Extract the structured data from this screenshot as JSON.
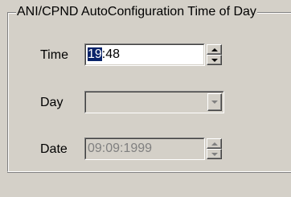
{
  "group": {
    "title": "ANI/CPND AutoConfiguration Time of Day"
  },
  "time": {
    "label": "Time",
    "hours": "19",
    "rest": ":48"
  },
  "day": {
    "label": "Day",
    "value": ""
  },
  "date": {
    "label": "Date",
    "value": "09:09:1999"
  },
  "colors": {
    "selection": "#0a246a",
    "face": "#d4d0c8",
    "disabled_text": "#808080"
  },
  "icons": {
    "spin_up": "arrow-up-icon",
    "spin_down": "arrow-down-icon",
    "dropdown": "chevron-down-icon"
  }
}
